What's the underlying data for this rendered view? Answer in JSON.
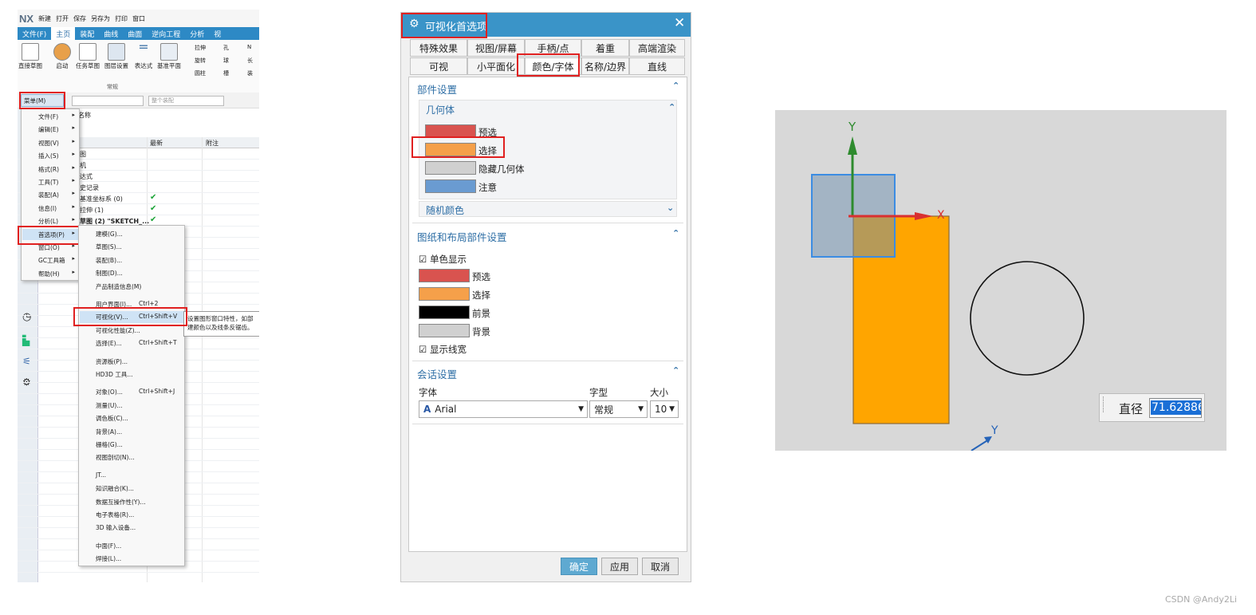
{
  "nx_window": {
    "logo": "NX",
    "quick_toolbar": [
      "新建",
      "打开",
      "保存",
      "另存为",
      "打印",
      "窗口"
    ],
    "ribbon_tabs": [
      "文件(F)",
      "主页",
      "装配",
      "曲线",
      "曲面",
      "逆向工程",
      "分析",
      "视"
    ],
    "ribbon_buttons": [
      "直接草图",
      "启动",
      "任务草图",
      "图层设置",
      "表达式",
      "基准平面"
    ],
    "ribbon_small": [
      "拉伸",
      "孔",
      "N",
      "旋转",
      "球",
      "长",
      "圆柱",
      "槽",
      "装"
    ],
    "group_label": "常规",
    "menu_button": "菜单(M)",
    "filter_placeholder": "整个装配",
    "col_headers": [
      "最新",
      "附注"
    ],
    "tree_header": "名称",
    "tree_items": [
      {
        "label": "图",
        "check": false
      },
      {
        "label": "机",
        "check": false
      },
      {
        "label": "达式",
        "check": false
      },
      {
        "label": "史记录",
        "check": false
      },
      {
        "label": "基准坐标系 (0)",
        "check": true
      },
      {
        "label": "拉伸 (1)",
        "check": true
      },
      {
        "label": "草图 (2) \"SKETCH_...",
        "check": true
      }
    ],
    "main_menu": [
      "文件(F)",
      "编辑(E)",
      "视图(V)",
      "插入(S)",
      "格式(R)",
      "工具(T)",
      "装配(A)",
      "信息(I)",
      "分析(L)",
      "首选项(P)",
      "窗口(O)",
      "GC工具箱",
      "帮助(H)"
    ],
    "prefs_submenu": [
      {
        "label": "建模(G)...",
        "shortcut": ""
      },
      {
        "label": "草图(S)...",
        "shortcut": ""
      },
      {
        "label": "装配(B)...",
        "shortcut": ""
      },
      {
        "label": "制图(D)...",
        "shortcut": ""
      },
      {
        "label": "产品制造信息(M)",
        "shortcut": ""
      },
      {
        "label": "用户界面(I)...",
        "shortcut": "Ctrl+2"
      },
      {
        "label": "可视化(V)...",
        "shortcut": "Ctrl+Shift+V"
      },
      {
        "label": "可视化性能(Z)...",
        "shortcut": ""
      },
      {
        "label": "选择(E)...",
        "shortcut": "Ctrl+Shift+T"
      },
      {
        "label": "资源板(P)...",
        "shortcut": ""
      },
      {
        "label": "HD3D 工具...",
        "shortcut": ""
      },
      {
        "label": "对象(O)...",
        "shortcut": "Ctrl+Shift+J"
      },
      {
        "label": "测量(U)...",
        "shortcut": ""
      },
      {
        "label": "调色板(C)...",
        "shortcut": ""
      },
      {
        "label": "背景(A)...",
        "shortcut": ""
      },
      {
        "label": "栅格(G)...",
        "shortcut": ""
      },
      {
        "label": "视图剖切(N)...",
        "shortcut": ""
      },
      {
        "label": "JT...",
        "shortcut": ""
      },
      {
        "label": "知识融合(K)...",
        "shortcut": ""
      },
      {
        "label": "数据互操作性(Y)...",
        "shortcut": ""
      },
      {
        "label": "电子表格(R)...",
        "shortcut": ""
      },
      {
        "label": "3D 输入设备...",
        "shortcut": ""
      },
      {
        "label": "中面(F)...",
        "shortcut": ""
      },
      {
        "label": "焊接(L)...",
        "shortcut": ""
      }
    ],
    "tooltip": [
      "设置图形窗口特性，如部",
      "建颜色以及线条反锯齿。"
    ]
  },
  "dialog": {
    "title": "可视化首选项",
    "tabs_row1": [
      "特殊效果",
      "视图/屏幕",
      "手柄/点",
      "着重",
      "高端渲染"
    ],
    "tabs_row2": [
      "可视",
      "小平面化",
      "颜色/字体",
      "名称/边界",
      "直线"
    ],
    "active_tab": "颜色/字体",
    "section_part": "部件设置",
    "subsection_geometry": "几何体",
    "geometry_colors": [
      {
        "label": "预选",
        "color": "#d9534f"
      },
      {
        "label": "选择",
        "color": "#f5a04a"
      },
      {
        "label": "隐藏几何体",
        "color": "#d0d0d0"
      },
      {
        "label": "注意",
        "color": "#6a9bd1"
      }
    ],
    "subsection_random": "随机颜色",
    "section_drawing": "图纸和布局部件设置",
    "mono_display_label": "单色显示",
    "drawing_colors": [
      {
        "label": "预选",
        "color": "#d9534f"
      },
      {
        "label": "选择",
        "color": "#f5a04a"
      },
      {
        "label": "前景",
        "color": "#000000"
      },
      {
        "label": "背景",
        "color": "#d0d0d0"
      }
    ],
    "show_linewidth_label": "显示线宽",
    "section_session": "会话设置",
    "font_label": "字体",
    "style_label": "字型",
    "size_label": "大小",
    "font_value": "Arial",
    "style_value": "常规",
    "size_value": "10",
    "ok_label": "确定",
    "apply_label": "应用",
    "cancel_label": "取消"
  },
  "viewport": {
    "axis_y": "Y",
    "axis_x": "X",
    "axis_y2": "Y",
    "dim_label": "直径",
    "dim_value": "71.62886"
  },
  "watermark": "CSDN @Andy2Li"
}
